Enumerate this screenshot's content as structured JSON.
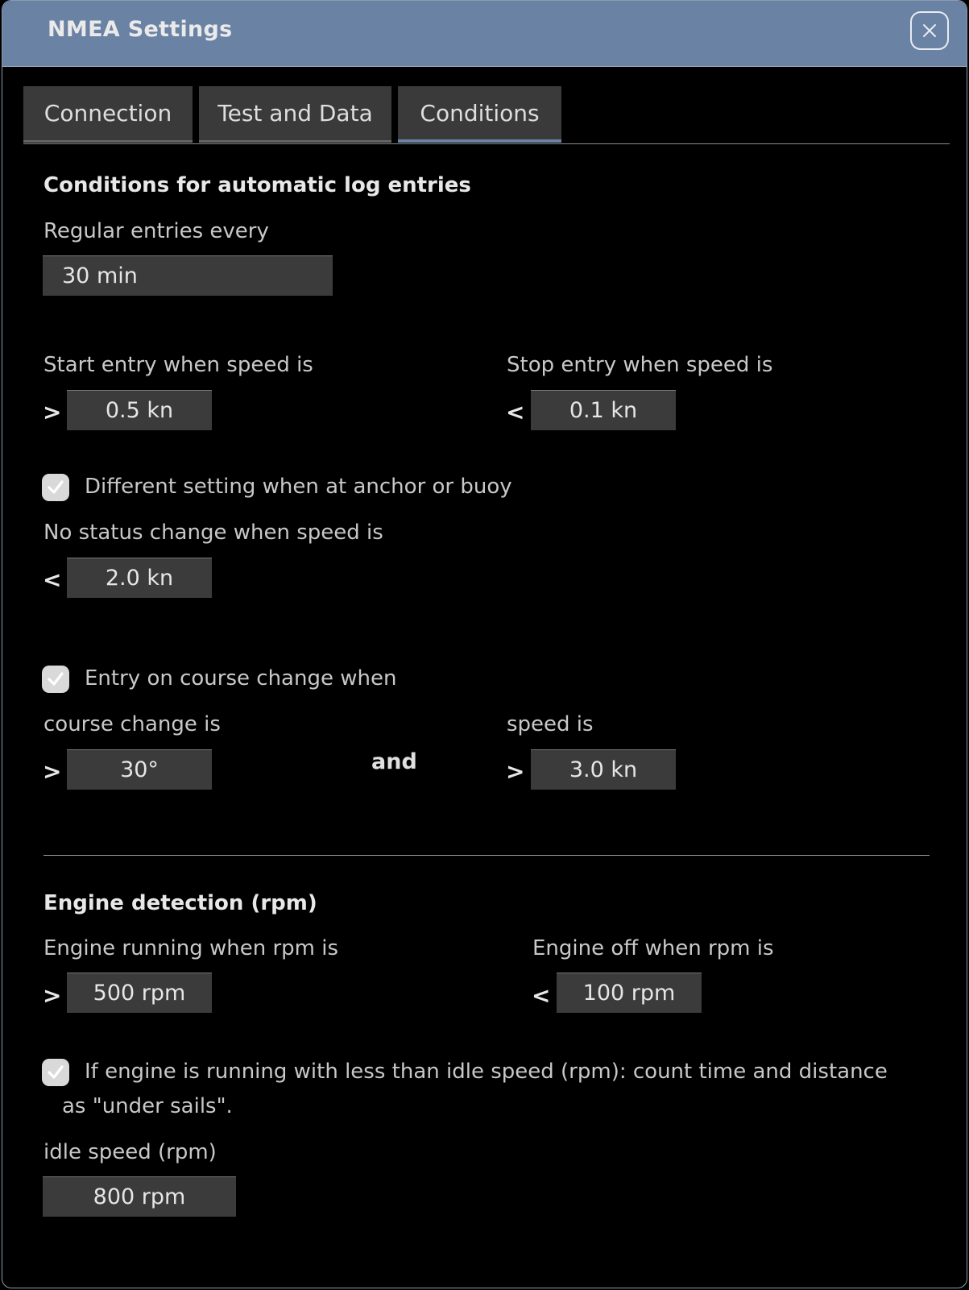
{
  "window": {
    "title": "NMEA Settings",
    "close_icon": "close-icon"
  },
  "tabs": [
    {
      "label": "Connection",
      "active": false
    },
    {
      "label": "Test and Data",
      "active": false
    },
    {
      "label": "Conditions",
      "active": true
    }
  ],
  "conditions": {
    "section_title": "Conditions for automatic log entries",
    "regular_label": "Regular entries every",
    "regular_value": "30 min",
    "start_label": "Start entry when speed is",
    "start_op": ">",
    "start_value": "0.5 kn",
    "stop_label": "Stop entry when speed is",
    "stop_op": "<",
    "stop_value": "0.1 kn",
    "anchor_checkbox_label": "Different setting when at anchor or buoy",
    "anchor_checked": true,
    "no_status_label": "No status change when speed is",
    "no_status_op": "<",
    "no_status_value": "2.0 kn",
    "course_checkbox_label": "Entry on course change when",
    "course_checked": true,
    "course_change_label": "course change is",
    "course_change_op": ">",
    "course_change_value": "30°",
    "and_label": "and",
    "speed_label": "speed is",
    "speed_op": ">",
    "speed_value": "3.0 kn"
  },
  "engine": {
    "section_title": "Engine detection (rpm)",
    "running_label": "Engine running when rpm is",
    "running_op": ">",
    "running_value": "500 rpm",
    "off_label": "Engine off when rpm is",
    "off_op": "<",
    "off_value": "100 rpm",
    "idle_checkbox_line1": "If engine is running with less than idle speed (rpm): count time and distance",
    "idle_checkbox_line2": "as \"under sails\".",
    "idle_checked": true,
    "idle_label": "idle speed (rpm)",
    "idle_value": "800 rpm"
  },
  "colors": {
    "titlebar": "#6a82a3",
    "field_bg": "#3b3b3b",
    "tab_active_accent": "#6a82a3",
    "background": "#000000"
  }
}
